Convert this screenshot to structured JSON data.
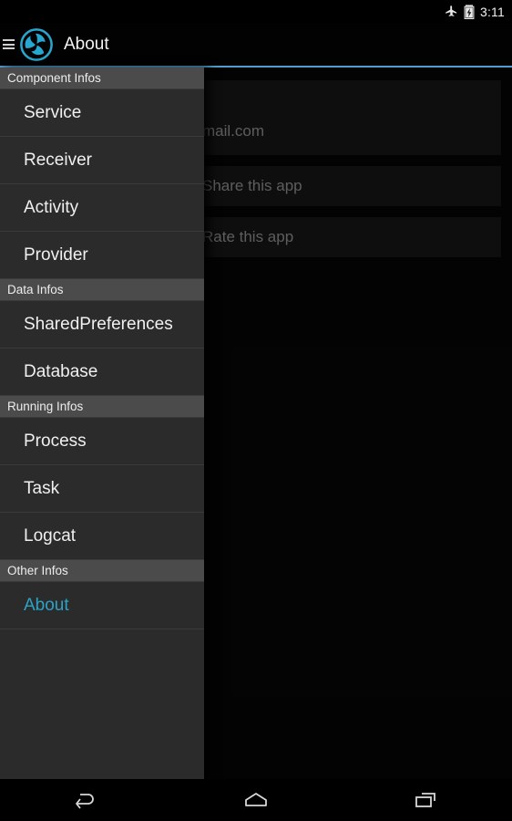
{
  "status_bar": {
    "icons": [
      {
        "name": "airplane-mode-icon",
        "glyph": "airplane"
      },
      {
        "name": "battery-charging-icon",
        "glyph": "battery"
      }
    ],
    "time": "3:11"
  },
  "action_bar": {
    "menu_icon": "hamburger-menu-icon",
    "logo_icon": "app-logo-icon",
    "title": "About",
    "accent_color": "#4f9dd0"
  },
  "drawer": {
    "accent_color": "#2ba3c6",
    "sections": [
      {
        "header": "Component Infos",
        "items": [
          {
            "label": "Service",
            "selected": false
          },
          {
            "label": "Receiver",
            "selected": false
          },
          {
            "label": "Activity",
            "selected": false
          },
          {
            "label": "Provider",
            "selected": false
          }
        ]
      },
      {
        "header": "Data Infos",
        "items": [
          {
            "label": "SharedPreferences",
            "selected": false
          },
          {
            "label": "Database",
            "selected": false
          }
        ]
      },
      {
        "header": "Running Infos",
        "items": [
          {
            "label": "Process",
            "selected": false
          },
          {
            "label": "Task",
            "selected": false
          },
          {
            "label": "Logcat",
            "selected": false
          }
        ]
      },
      {
        "header": "Other Infos",
        "items": [
          {
            "label": "About",
            "selected": true
          }
        ]
      }
    ]
  },
  "content": {
    "cards": [
      {
        "name": "email-card",
        "text": "mail.com"
      },
      {
        "name": "share-app-card",
        "text": "Share this app"
      },
      {
        "name": "rate-app-card",
        "text": "Rate this app"
      }
    ]
  },
  "nav_bar": {
    "buttons": [
      {
        "name": "back-button",
        "icon": "back-arrow-icon"
      },
      {
        "name": "home-button",
        "icon": "home-icon"
      },
      {
        "name": "recents-button",
        "icon": "recents-icon"
      }
    ]
  }
}
